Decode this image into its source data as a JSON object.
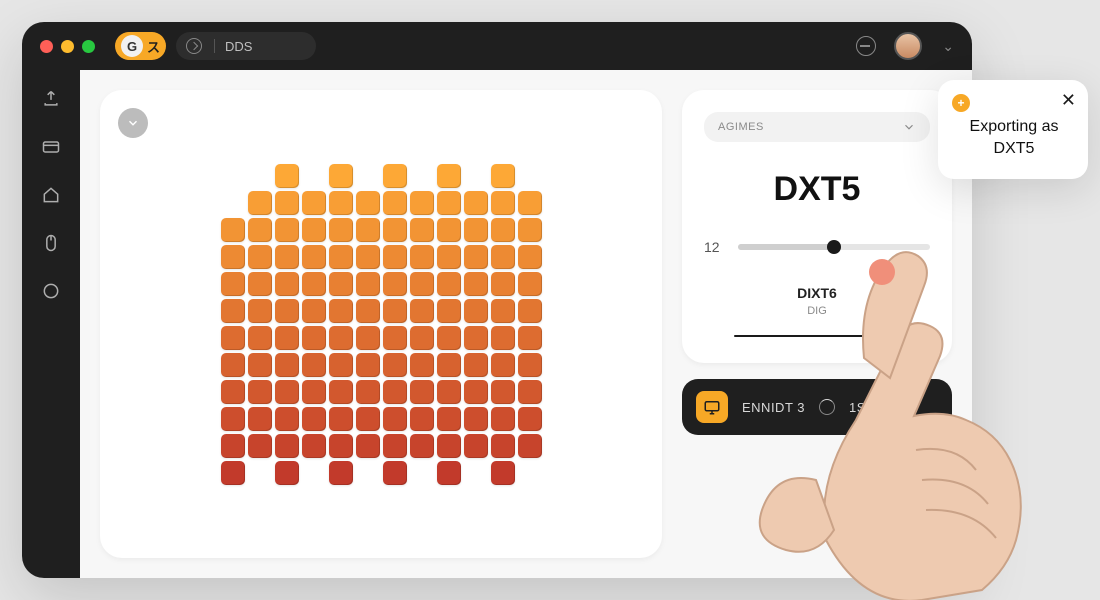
{
  "titlebar": {
    "format_pill_letter": "G",
    "format_pill_glyph": "ス",
    "address_text": "DDS"
  },
  "rail": {
    "items": [
      {
        "name": "export-icon"
      },
      {
        "name": "card-icon"
      },
      {
        "name": "home-icon"
      },
      {
        "name": "mouse-icon"
      },
      {
        "name": "circle-icon"
      }
    ]
  },
  "panel": {
    "preset_dropdown_label": "AGIMES",
    "format_label": "DXT5",
    "slider_value": "12",
    "secondary_title": "DIXT6",
    "secondary_sub": "DIG"
  },
  "status": {
    "text_a": "ENNIDT 3",
    "text_b": "1SEESTT"
  },
  "toast": {
    "message_line1": "Exporting as",
    "message_line2": "DXT5"
  },
  "colors": {
    "accent": "#f7a826",
    "grad_top": "#fda836",
    "grad_bot": "#c23a2b"
  }
}
